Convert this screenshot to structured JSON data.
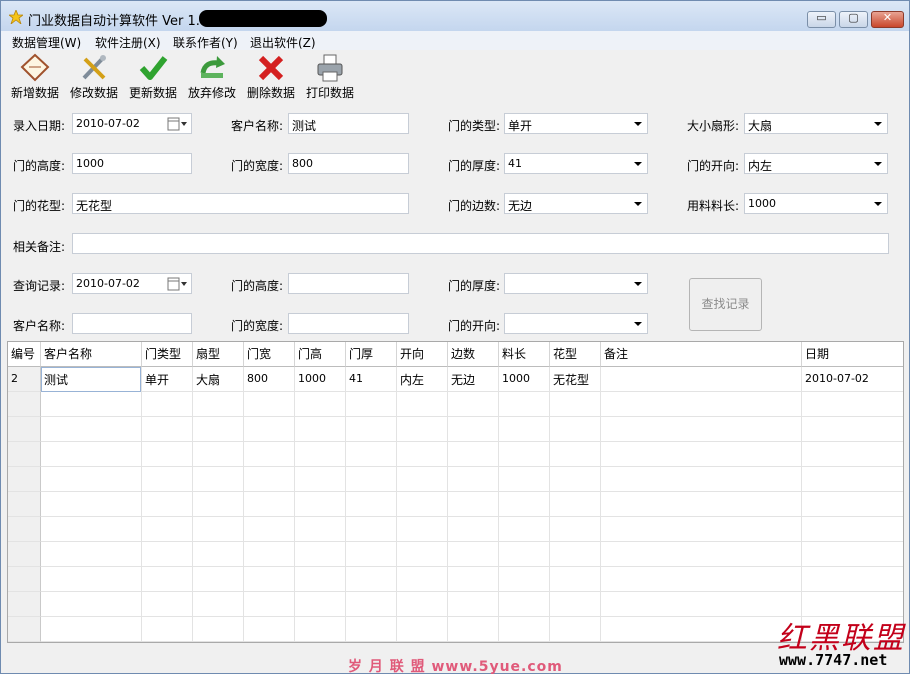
{
  "window": {
    "title": "门业数据自动计算软件 Ver 1.0",
    "controls": {
      "minimize": "▭",
      "maximize": "▢",
      "close": "✕"
    }
  },
  "menu": [
    "数据管理(W)",
    "软件注册(X)",
    "联系作者(Y)",
    "退出软件(Z)"
  ],
  "toolbar": [
    {
      "label": "新增数据",
      "icon": "new-document-icon"
    },
    {
      "label": "修改数据",
      "icon": "edit-tools-icon"
    },
    {
      "label": "更新数据",
      "icon": "checkmark-icon"
    },
    {
      "label": "放弃修改",
      "icon": "undo-arrow-icon"
    },
    {
      "label": "删除数据",
      "icon": "delete-x-icon"
    },
    {
      "label": "打印数据",
      "icon": "printer-icon"
    }
  ],
  "form": {
    "entry_date": {
      "label": "录入日期:",
      "value": "2010-07-02"
    },
    "customer": {
      "label": "客户名称:",
      "value": "测试"
    },
    "door_type": {
      "label": "门的类型:",
      "value": "单开"
    },
    "fan_size": {
      "label": "大小扇形:",
      "value": "大扇"
    },
    "height": {
      "label": "门的高度:",
      "value": "1000"
    },
    "width": {
      "label": "门的宽度:",
      "value": "800"
    },
    "thickness": {
      "label": "门的厚度:",
      "value": "41"
    },
    "opening": {
      "label": "门的开向:",
      "value": "内左"
    },
    "pattern": {
      "label": "门的花型:",
      "value": "无花型"
    },
    "edges": {
      "label": "门的边数:",
      "value": "无边"
    },
    "material_length": {
      "label": "用料料长:",
      "value": "1000"
    },
    "remarks": {
      "label": "相关备注:",
      "value": ""
    }
  },
  "query": {
    "record_date": {
      "label": "查询记录:",
      "value": "2010-07-02"
    },
    "height": {
      "label": "门的高度:",
      "value": ""
    },
    "thickness": {
      "label": "门的厚度:",
      "value": ""
    },
    "customer": {
      "label": "客户名称:",
      "value": ""
    },
    "width": {
      "label": "门的宽度:",
      "value": ""
    },
    "opening": {
      "label": "门的开向:",
      "value": ""
    },
    "search_button": "查找记录"
  },
  "grid": {
    "columns": [
      "编号",
      "客户名称",
      "门类型",
      "扇型",
      "门宽",
      "门高",
      "门厚",
      "开向",
      "边数",
      "料长",
      "花型",
      "备注",
      "日期"
    ],
    "rows": [
      [
        "2",
        "测试",
        "单开",
        "大扇",
        "800",
        "1000",
        "41",
        "内左",
        "无边",
        "1000",
        "无花型",
        "",
        "2010-07-02"
      ]
    ]
  },
  "watermarks": {
    "logo": "红黑联盟",
    "site": "www.7747.net",
    "bottom": "岁 月 联 盟  www.5yue.com"
  }
}
